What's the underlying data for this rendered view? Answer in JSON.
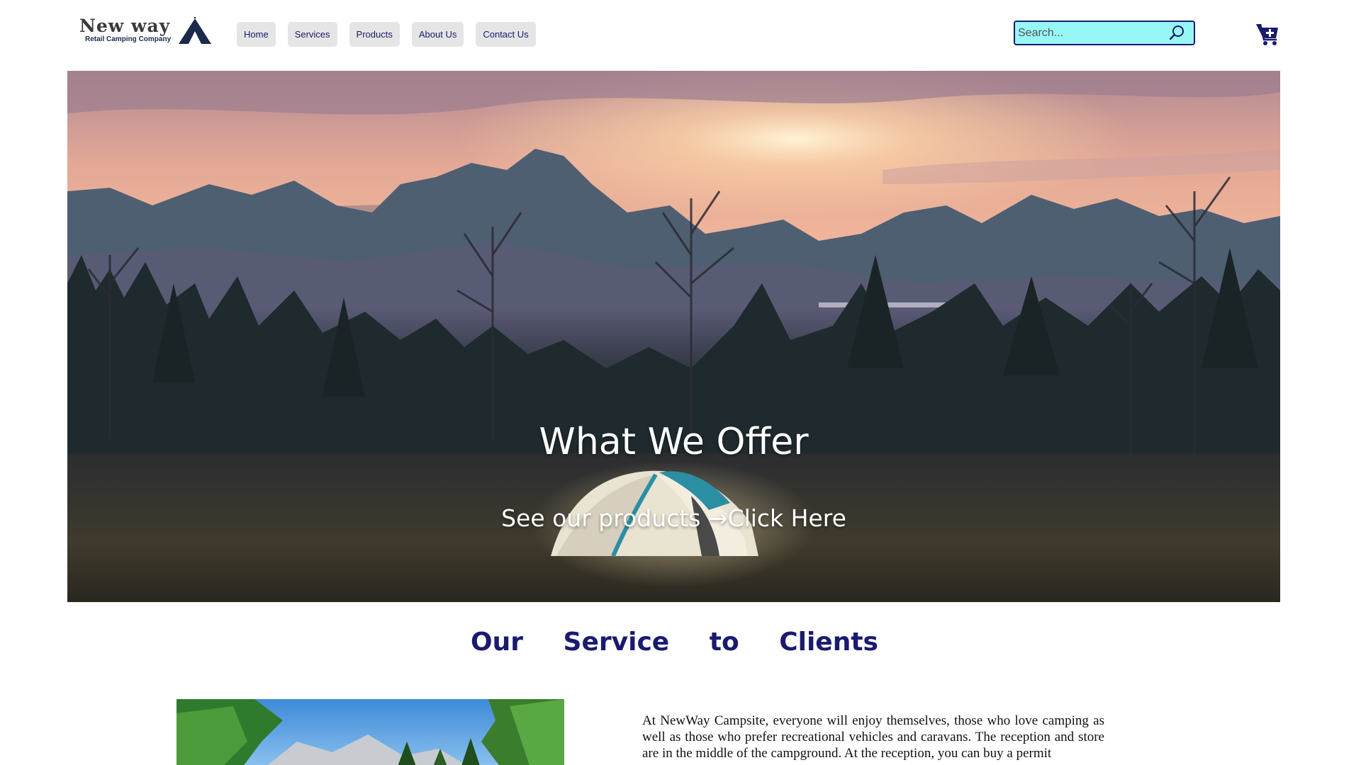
{
  "header": {
    "logo_name": "New way",
    "logo_tagline": "Retail Camping Company",
    "nav": [
      {
        "label": "Home"
      },
      {
        "label": "Services"
      },
      {
        "label": "Products"
      },
      {
        "label": "About Us"
      },
      {
        "label": "Contact Us"
      }
    ],
    "search": {
      "placeholder": "Search..."
    },
    "icons": {
      "search": "search-icon",
      "cart": "cart-plus-icon",
      "logo": "tent-icon"
    }
  },
  "hero": {
    "title": "What We Offer",
    "cta_text": "See our products →",
    "cta_link": "Click Here"
  },
  "services": {
    "title": "Our Service to Clients",
    "paragraph": "At NewWay Campsite, everyone will enjoy themselves, those who love camping as well as those who prefer recreational vehicles and caravans. The reception and store are in the middle of the campground. At the reception, you can buy a permit"
  },
  "colors": {
    "accent": "#1a1a6e",
    "nav_bg": "#e5e5e5",
    "search_bg": "#97f7f7"
  }
}
